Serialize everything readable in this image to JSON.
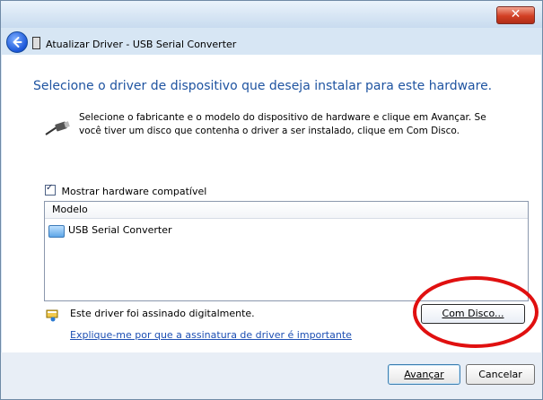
{
  "window": {
    "close_label": "✕"
  },
  "nav": {
    "title": "Atualizar Driver - USB Serial Converter"
  },
  "main": {
    "heading": "Selecione o driver de dispositivo que deseja instalar para este hardware.",
    "intro_text": "Selecione o fabricante e o modelo do dispositivo de hardware e clique em Avançar. Se você tiver um disco que contenha o driver a ser instalado, clique em Com Disco.",
    "compatible_checkbox_label": "Mostrar hardware compatível",
    "list": {
      "header": "Modelo",
      "items": [
        "USB Serial Converter"
      ]
    },
    "signed_text": "Este driver foi assinado digitalmente.",
    "signature_link": "Explique-me por que a assinatura de driver é importante",
    "have_disk_label": "Com Disco..."
  },
  "buttons": {
    "next_label": "Avançar",
    "cancel_label": "Cancelar"
  },
  "colors": {
    "heading": "#1f54a1",
    "link": "#1d4fb3",
    "annotation_circle": "#e01010"
  }
}
